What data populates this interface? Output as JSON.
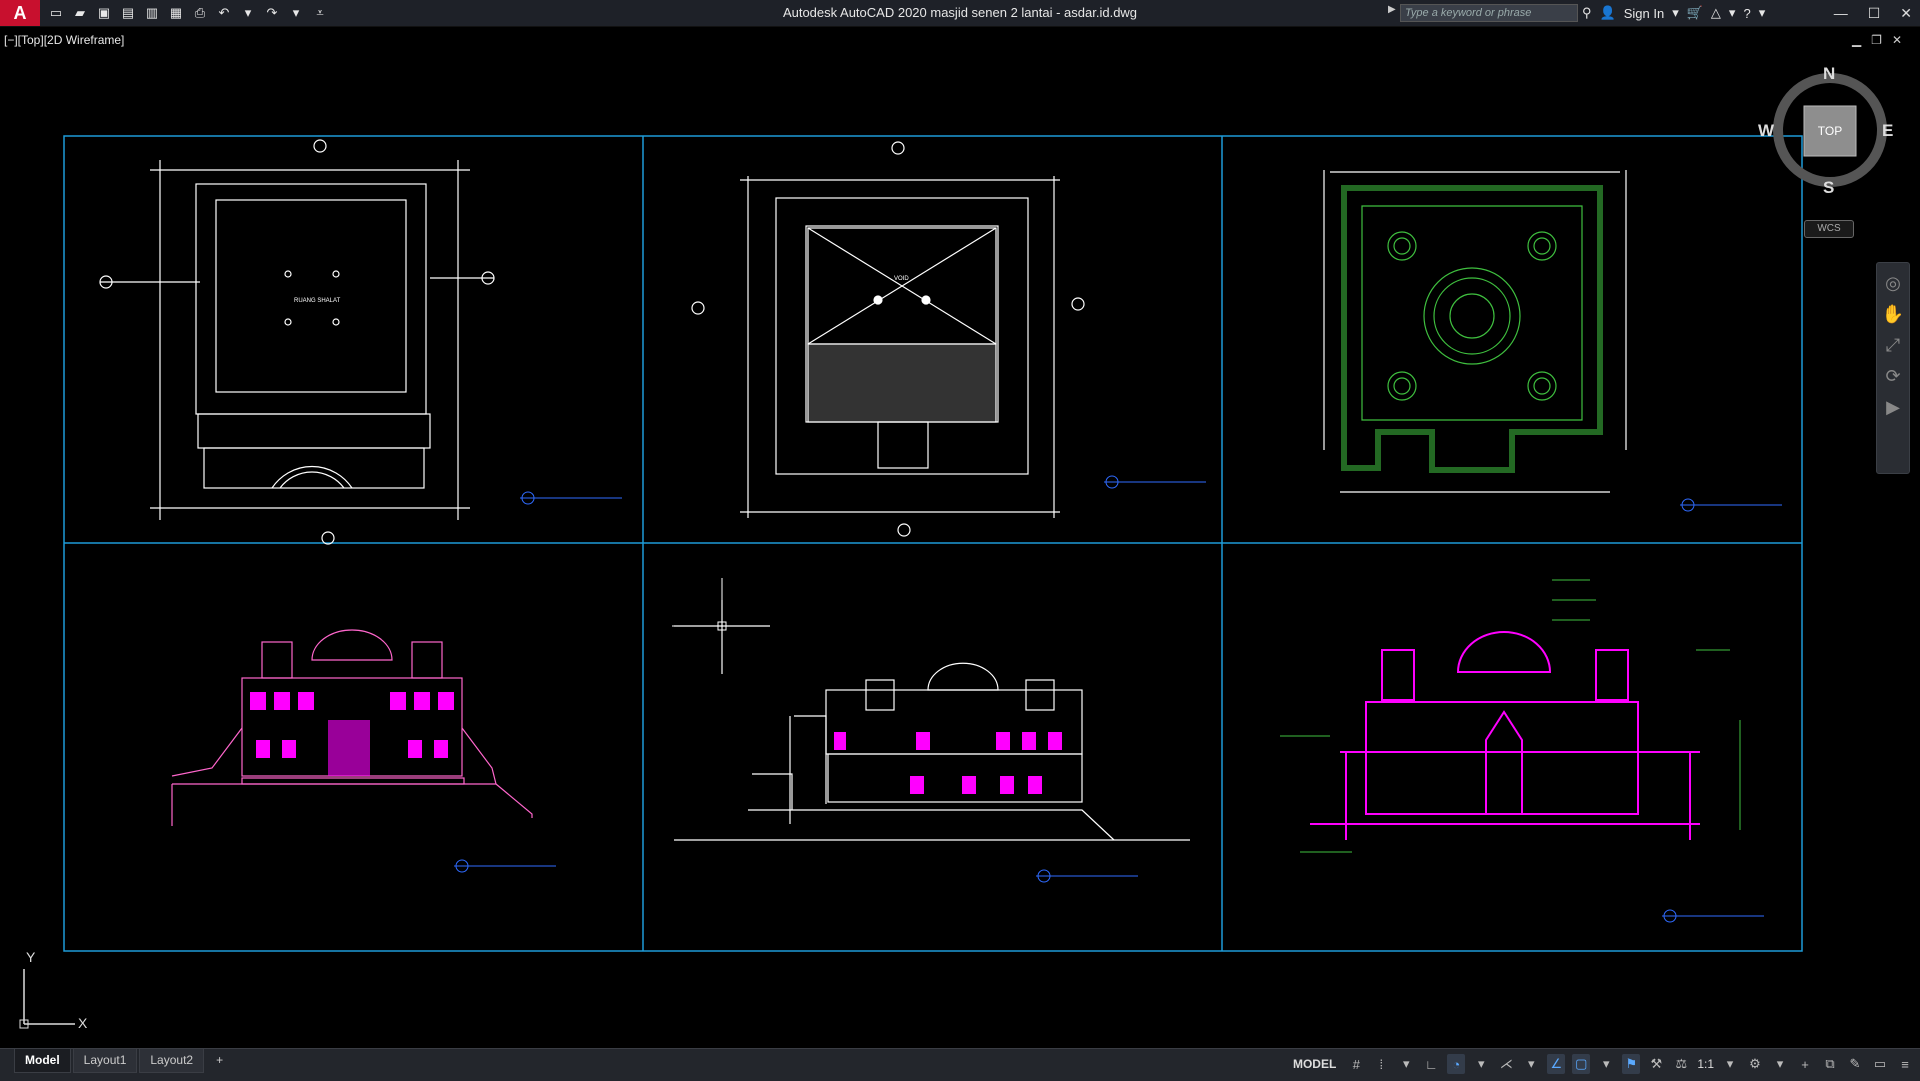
{
  "title_bar": {
    "app_logo": "A",
    "title": "Autodesk AutoCAD 2020    masjid senen 2 lantai - asdar.id.dwg",
    "search_placeholder": "Type a keyword or phrase",
    "sign_in": "Sign In"
  },
  "viewport": {
    "label": "[−][Top][2D Wireframe]"
  },
  "viewcube": {
    "north": "N",
    "south": "S",
    "east": "E",
    "west": "W",
    "face": "TOP",
    "wcs": "WCS"
  },
  "ucs": {
    "x_label": "X",
    "y_label": "Y"
  },
  "drawing": {
    "plan_labels": [
      "RUANG SHALAT",
      "VOID"
    ],
    "wireframe_color": "#ffffff",
    "frame_color": "#1e9bd7",
    "elevation_color_1": "#ff66cc",
    "elevation_color_2": "#ff00ff",
    "green_color": "#3fbf3f"
  },
  "layout_tabs": [
    "Model",
    "Layout1",
    "Layout2",
    "+"
  ],
  "status_bar": {
    "model": "MODEL",
    "scale": "1:1"
  },
  "colors": {
    "background": "#000000",
    "titlebar": "#1e2128",
    "brand": "#c8102e",
    "statusbar": "#23262c"
  }
}
